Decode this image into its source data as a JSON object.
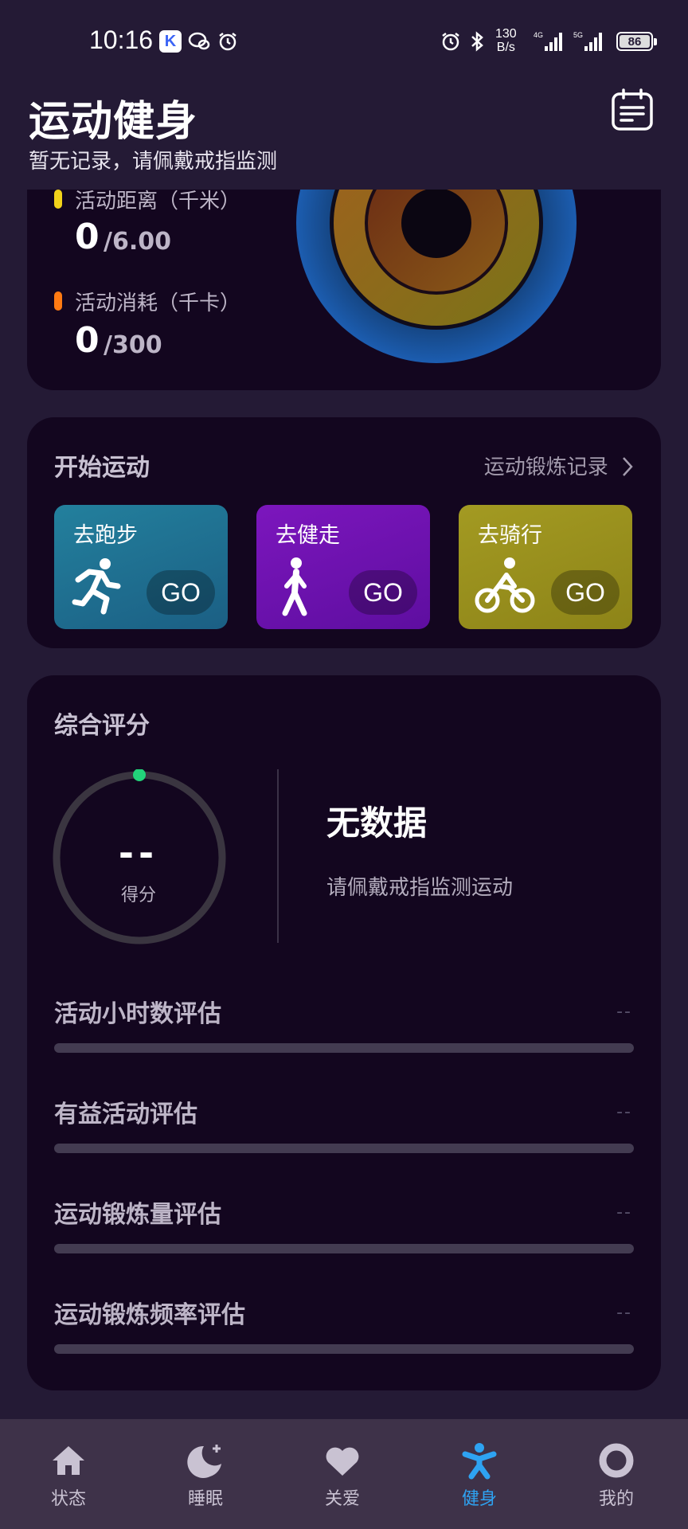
{
  "status_bar": {
    "time": "10:16",
    "app_badge": "K",
    "net_speed_value": "130",
    "net_speed_unit": "B/s",
    "battery": "86"
  },
  "header": {
    "title": "运动健身",
    "subtitle": "暂无记录，请佩戴戒指监测"
  },
  "activity_summary": {
    "distance_label": "活动距离（千米）",
    "distance_value": "0",
    "distance_goal": "/6.00",
    "calories_label": "活动消耗（千卡）",
    "calories_value": "0",
    "calories_goal": "/300",
    "colors": {
      "distance": "#f2d21a",
      "calories": "#ff7a12"
    }
  },
  "start_exercise": {
    "title": "开始运动",
    "records_link": "运动锻炼记录",
    "buttons": [
      {
        "label": "去跑步",
        "go": "GO",
        "icon": "running-icon",
        "color": "#1c6e92"
      },
      {
        "label": "去健走",
        "go": "GO",
        "icon": "walking-icon",
        "color": "#6a12ab"
      },
      {
        "label": "去骑行",
        "go": "GO",
        "icon": "cycling-icon",
        "color": "#9a8f1b"
      }
    ]
  },
  "score": {
    "title": "综合评分",
    "value": "--",
    "label": "得分",
    "status": "无数据",
    "hint": "请佩戴戒指监测运动",
    "evaluations": [
      {
        "label": "活动小时数评估",
        "value": "--"
      },
      {
        "label": "有益活动评估",
        "value": "--"
      },
      {
        "label": "运动锻炼量评估",
        "value": "--"
      },
      {
        "label": "运动锻炼频率评估",
        "value": "--"
      }
    ]
  },
  "nav": {
    "items": [
      {
        "label": "状态",
        "icon": "home-icon"
      },
      {
        "label": "睡眠",
        "icon": "moon-icon"
      },
      {
        "label": "关爱",
        "icon": "heart-icon"
      },
      {
        "label": "健身",
        "icon": "fitness-icon",
        "active": true
      },
      {
        "label": "我的",
        "icon": "profile-icon"
      }
    ]
  }
}
